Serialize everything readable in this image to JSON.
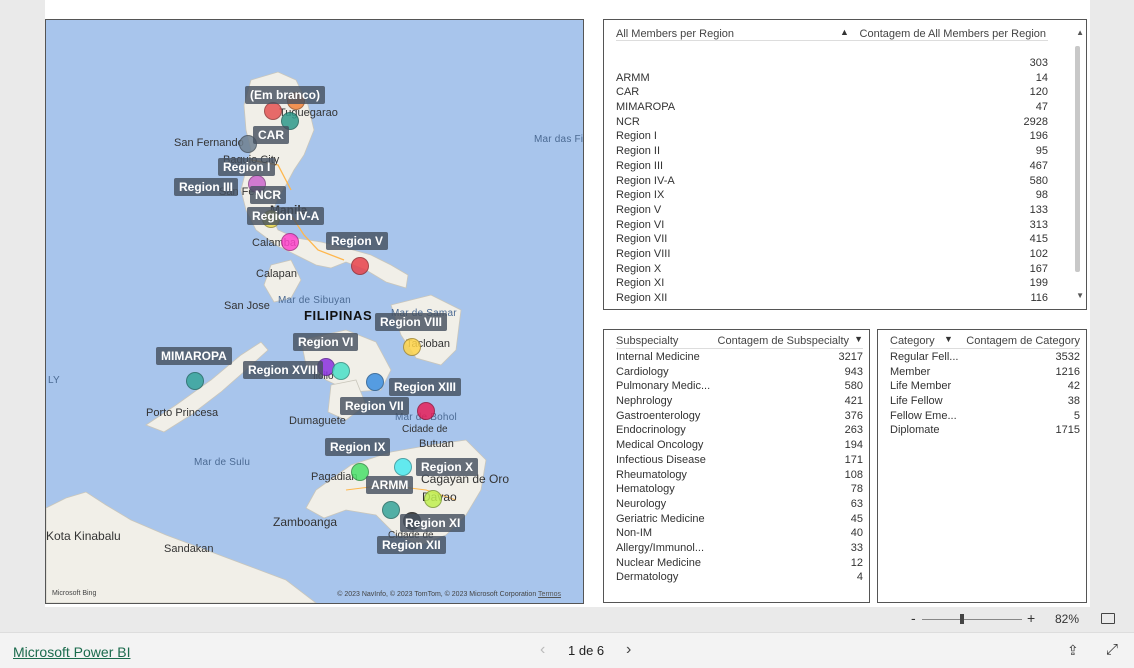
{
  "map": {
    "country": "FILIPINAS",
    "cities": [
      "Tuguegarao",
      "San Fernando",
      "Baguio City",
      "San Fern",
      "Manila",
      "Calamba",
      "Calapan",
      "San Jose",
      "Porto Princesa",
      "Dumaguete",
      "Iloilo",
      "Pagadian",
      "Zamboanga",
      "Davao",
      "Cidade de",
      "Butuan",
      "Tacloban",
      "Cagayan de Oro",
      "Kota Kinabalu",
      "Sandakan",
      "Cidade de"
    ],
    "seas": [
      "Mar das Fi",
      "Mar de Sibuyan",
      "Mar de Samar",
      "Mar de Bohol",
      "Mar de Sulu",
      "LY"
    ],
    "regions": [
      "(Em branco)",
      "CAR",
      "Region I",
      "Region III",
      "NCR",
      "Region IV-A",
      "Region V",
      "MIMAROPA",
      "Region VI",
      "Region XVIII",
      "Region VIII",
      "Region VII",
      "Region XIII",
      "Region IX",
      "Region X",
      "ARMM",
      "Region XI",
      "Region XII"
    ],
    "attribution": "© 2023 NavInfo, © 2023 TomTom, © 2023 Microsoft Corporation",
    "terms": "Termos",
    "bing": "Microsoft Bing",
    "colors": [
      "#e55353",
      "#f0823a",
      "#2f9a8b",
      "#6f8090",
      "#cc66cc",
      "#6a8a9a",
      "#e8d84a",
      "#ff44cc",
      "#e8424a",
      "#37a59a",
      "#ffd54a",
      "#8a30e0",
      "#4ae0c8",
      "#3a8ee0",
      "#e8205a",
      "#4ae06a",
      "#4ae8f0",
      "#c0f050",
      "#2a2a2a"
    ]
  },
  "regions_table": {
    "col1": "All Members per Region",
    "col2": "Contagem de All Members per Region",
    "rows": [
      {
        "k": "",
        "v": "303"
      },
      {
        "k": "ARMM",
        "v": "14"
      },
      {
        "k": "CAR",
        "v": "120"
      },
      {
        "k": "MIMAROPA",
        "v": "47"
      },
      {
        "k": "NCR",
        "v": "2928"
      },
      {
        "k": "Region I",
        "v": "196"
      },
      {
        "k": "Region II",
        "v": "95"
      },
      {
        "k": "Region III",
        "v": "467"
      },
      {
        "k": "Region IV-A",
        "v": "580"
      },
      {
        "k": "Region IX",
        "v": "98"
      },
      {
        "k": "Region V",
        "v": "133"
      },
      {
        "k": "Region VI",
        "v": "313"
      },
      {
        "k": "Region VII",
        "v": "415"
      },
      {
        "k": "Region VIII",
        "v": "102"
      },
      {
        "k": "Region X",
        "v": "167"
      },
      {
        "k": "Region XI",
        "v": "199"
      },
      {
        "k": "Region XII",
        "v": "116"
      }
    ]
  },
  "subspecialty_table": {
    "col1": "Subspecialty",
    "col2": "Contagem de Subspecialty",
    "rows": [
      {
        "k": "Internal Medicine",
        "v": "3217"
      },
      {
        "k": "Cardiology",
        "v": "943"
      },
      {
        "k": "Pulmonary Medic...",
        "v": "580"
      },
      {
        "k": "Nephrology",
        "v": "421"
      },
      {
        "k": "Gastroenterology",
        "v": "376"
      },
      {
        "k": "Endocrinology",
        "v": "263"
      },
      {
        "k": "Medical Oncology",
        "v": "194"
      },
      {
        "k": "Infectious Disease",
        "v": "171"
      },
      {
        "k": "Rheumatology",
        "v": "108"
      },
      {
        "k": "Hematology",
        "v": "78"
      },
      {
        "k": "Neurology",
        "v": "63"
      },
      {
        "k": "Geriatric Medicine",
        "v": "45"
      },
      {
        "k": "Non-IM",
        "v": "40"
      },
      {
        "k": "Allergy/Immunol...",
        "v": "33"
      },
      {
        "k": "Nuclear Medicine",
        "v": "12"
      },
      {
        "k": "Dermatology",
        "v": "4"
      }
    ]
  },
  "category_table": {
    "col1": "Category",
    "col2": "Contagem de Category",
    "rows": [
      {
        "k": "Regular Fell...",
        "v": "3532"
      },
      {
        "k": "Member",
        "v": "1216"
      },
      {
        "k": "Life Member",
        "v": "42"
      },
      {
        "k": "Life Fellow",
        "v": "38"
      },
      {
        "k": "Fellow Eme...",
        "v": "5"
      },
      {
        "k": "Diplomate",
        "v": "1715"
      }
    ]
  },
  "zoom": {
    "minus": "-",
    "plus": "+",
    "level": "82%",
    "value": 0.82
  },
  "footer": {
    "brand": "Microsoft Power BI",
    "page": "1 de 6"
  }
}
